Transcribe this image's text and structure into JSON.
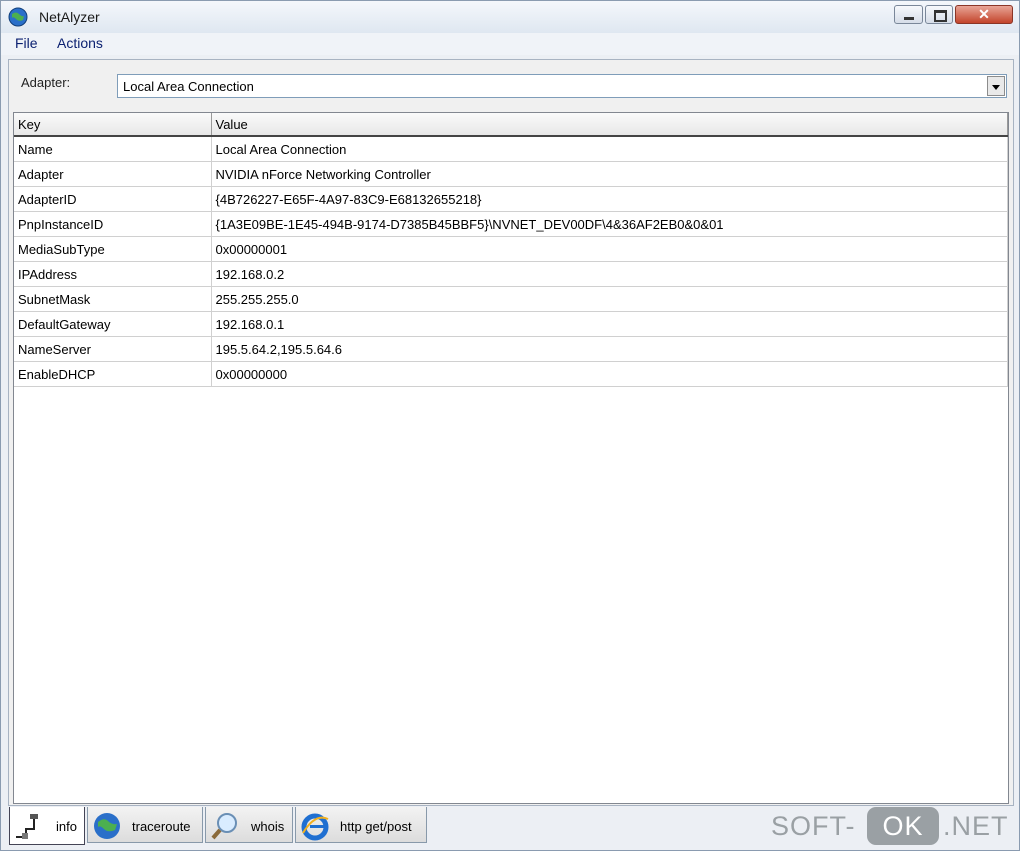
{
  "window": {
    "title": "NetAlyzer"
  },
  "menu": {
    "file": "File",
    "actions": "Actions"
  },
  "adapter": {
    "label": "Adapter:",
    "selected": "Local Area Connection"
  },
  "table": {
    "columns": [
      "Key",
      "Value"
    ],
    "rows": [
      [
        "Name",
        "Local Area Connection"
      ],
      [
        "Adapter",
        "NVIDIA nForce Networking Controller"
      ],
      [
        "AdapterID",
        "{4B726227-E65F-4A97-83C9-E68132655218}"
      ],
      [
        "PnpInstanceID",
        "{1A3E09BE-1E45-494B-9174-D7385B45BBF5}\\NVNET_DEV00DF\\4&36AF2EB0&0&01"
      ],
      [
        "MediaSubType",
        "0x00000001"
      ],
      [
        "IPAddress",
        "192.168.0.2"
      ],
      [
        "SubnetMask",
        "255.255.255.0"
      ],
      [
        "DefaultGateway",
        "192.168.0.1"
      ],
      [
        "NameServer",
        "195.5.64.2,195.5.64.6"
      ],
      [
        "EnableDHCP",
        "0x00000000"
      ]
    ]
  },
  "tabs": [
    {
      "label": "info",
      "icon": "network-plug-icon",
      "active": true
    },
    {
      "label": "traceroute",
      "icon": "globe-icon",
      "active": false
    },
    {
      "label": "whois",
      "icon": "magnifier-icon",
      "active": false
    },
    {
      "label": "http get/post",
      "icon": "ie-icon",
      "active": false
    }
  ],
  "watermark": {
    "part1": "SOFT-",
    "part2": "OK",
    "part3": ".NET"
  }
}
